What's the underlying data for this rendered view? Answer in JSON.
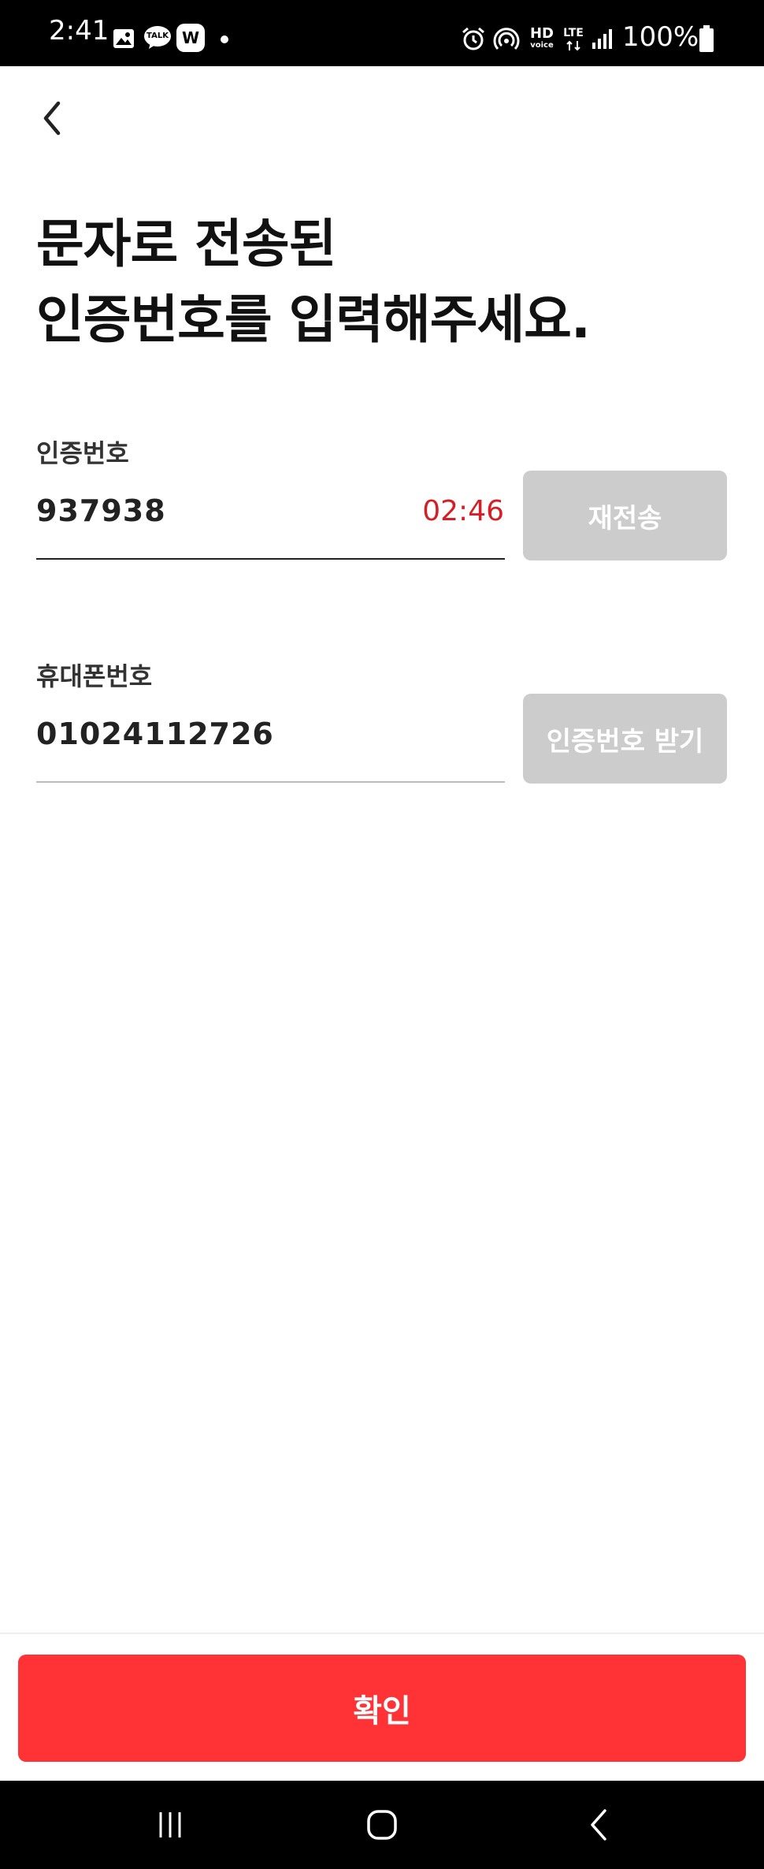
{
  "status_bar": {
    "time": "2:41",
    "notif_icons": [
      "gallery-icon",
      "kakaotalk-icon",
      "w-app-icon"
    ],
    "talk_badge": "TALK",
    "w_badge": "W",
    "hd_label": "HD",
    "voice_label": "voice",
    "lte_label": "LTE",
    "battery": "100%"
  },
  "header": {
    "back_icon": "chevron-left-icon"
  },
  "title": "문자로 전송된\n인증번호를 입력해주세요.",
  "verification": {
    "label": "인증번호",
    "value": "937938",
    "timer": "02:46",
    "resend_label": "재전송"
  },
  "phone": {
    "label": "휴대폰번호",
    "value": "01024112726",
    "request_label": "인증번호 받기"
  },
  "confirm_label": "확인",
  "nav_bar": {
    "icons": [
      "recents-icon",
      "home-icon",
      "back-icon"
    ]
  },
  "colors": {
    "accent": "#ff3236",
    "timer": "#d31f25",
    "disabled_button": "#cccccc"
  }
}
